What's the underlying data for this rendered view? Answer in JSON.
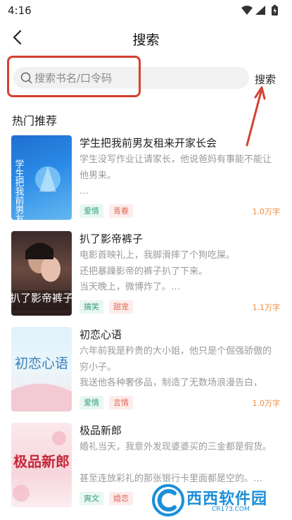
{
  "status_bar": {
    "time": "4:16"
  },
  "header": {
    "title": "搜索"
  },
  "search": {
    "placeholder": "搜索书名/口令码",
    "button_label": "搜索"
  },
  "section": {
    "title": "热门推荐"
  },
  "books": [
    {
      "title": "学生把我前男友租来开家长会",
      "desc": "学生没写作业让请家长，他说爸妈有事能不能让他男来。\n…",
      "tags": [
        "爱情",
        "青春"
      ],
      "wordcount": "1.0万字",
      "cover_text": "学生把我前男友租来开家长会"
    },
    {
      "title": "扒了影帝裤子",
      "desc": "电影首映礼上，我脚滑摔了个狗吃屎。\n还把暴躁影帝的裤子扒了下来。\n当天晚上，微博炸了。…",
      "tags": [
        "搞笑",
        "甜宠"
      ],
      "wordcount": "1.1万字",
      "cover_text": "扒了影帝裤子"
    },
    {
      "title": "初恋心语",
      "desc": "六年前我是矜贵的大小姐，他只是个倔强骄傲的穷小子。\n我送他各种奢侈品，制造了无数场浪漫告白，就…",
      "tags": [
        "爱情",
        "言情"
      ],
      "wordcount": "1.0万字",
      "cover_text": "初恋心语"
    },
    {
      "title": "极品新郎",
      "desc": "婚礼当天，我意外发现婆婆买的三金都是假货。\n\n甚至连放彩礼的那张银行卡里面都是空的。…",
      "tags": [
        "爽文",
        "婚恋"
      ],
      "wordcount": "",
      "cover_text": "极品新郎"
    }
  ],
  "watermark": {
    "text": "西西软件园",
    "url": "CR173.COM"
  },
  "colors": {
    "accent_red": "#d4412f",
    "tag_green": "#35a37f",
    "tag_red": "#e36a5a",
    "wordcount_orange": "#f08c3c"
  }
}
